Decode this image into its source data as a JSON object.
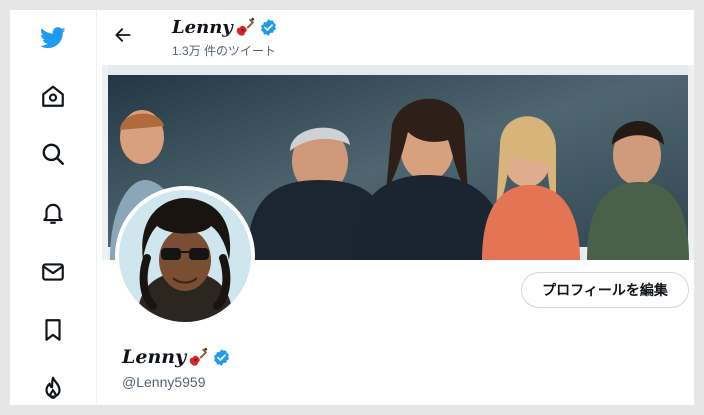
{
  "colors": {
    "brand": "#1d9bf0",
    "text_primary": "#0f1419",
    "text_secondary": "#536471",
    "border": "#cfd9de"
  },
  "sidebar": {
    "items": [
      {
        "icon": "twitter-bird-icon"
      },
      {
        "icon": "home-icon"
      },
      {
        "icon": "search-icon"
      },
      {
        "icon": "bell-icon"
      },
      {
        "icon": "mail-icon"
      },
      {
        "icon": "bookmark-icon"
      },
      {
        "icon": "flame-icon"
      }
    ]
  },
  "header": {
    "name": "Lenny",
    "tweet_count": "1.3万 件のツイート",
    "back_icon": "arrow-left-icon"
  },
  "profile": {
    "name": "Lenny",
    "handle": "@Lenny5959",
    "edit_button_label": "プロフィールを編集",
    "badges": [
      "guitar-emoji-icon",
      "verified-badge-icon"
    ]
  }
}
